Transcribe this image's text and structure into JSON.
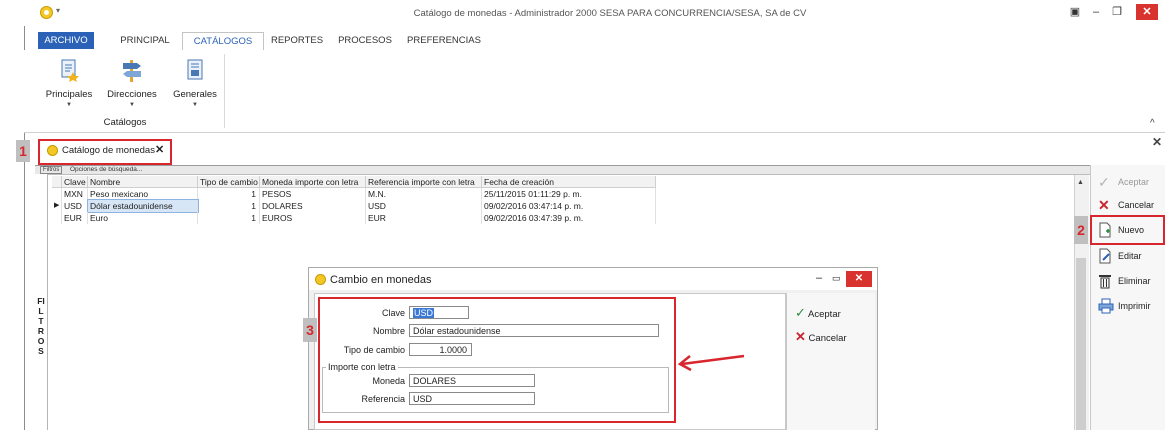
{
  "window": {
    "title": "Catálogo de monedas - Administrador 2000 SESA PARA CONCURRENCIA/SESA, SA de CV",
    "controls": {
      "restore": "▣",
      "minimize": "–",
      "maximize": "❐",
      "close": "✕"
    },
    "quick_access": "▾"
  },
  "ribbon": {
    "tabs": [
      "ARCHIVO",
      "PRINCIPAL",
      "CATÁLOGOS",
      "REPORTES",
      "PROCESOS",
      "PREFERENCIAS"
    ],
    "active_tab": "CATÁLOGOS",
    "buttons": [
      {
        "label": "Principales",
        "icon": "document-star-icon"
      },
      {
        "label": "Direcciones",
        "icon": "signpost-icon"
      },
      {
        "label": "Generales",
        "icon": "document-grid-icon"
      }
    ],
    "dropdown_glyph": "▼",
    "group_label": "Catálogos",
    "collapse_glyph": "^"
  },
  "document_tab": {
    "label": "Catálogo de monedas",
    "close": "✕",
    "close_right": "✕"
  },
  "annotations": {
    "badge1": "1",
    "badge2": "2",
    "badge3": "3",
    "accent": "#d7262d"
  },
  "search_bar": {
    "tab": "Filtros",
    "options": "Opciones de búsqueda..."
  },
  "filtros_label": "FILTROS",
  "grid": {
    "columns": [
      "Clave",
      "Nombre",
      "Tipo de cambio",
      "Moneda importe con letra",
      "Referencia importe con letra",
      "Fecha de creación"
    ],
    "rows": [
      {
        "indicator": "",
        "clave": "MXN",
        "nombre": "Peso mexicano",
        "tipo": "1",
        "moneda": "PESOS",
        "referencia": "M.N.",
        "fecha": "25/11/2015 01:11:29 p. m."
      },
      {
        "indicator": "▶",
        "clave": "USD",
        "nombre": "Dólar estadounidense",
        "tipo": "1",
        "moneda": "DOLARES",
        "referencia": "USD",
        "fecha": "09/02/2016 03:47:14 p. m."
      },
      {
        "indicator": "",
        "clave": "EUR",
        "nombre": "Euro",
        "tipo": "1",
        "moneda": "EUROS",
        "referencia": "EUR",
        "fecha": "09/02/2016 03:47:39 p. m."
      }
    ]
  },
  "side_actions": [
    "Aceptar",
    "Cancelar",
    "Nuevo",
    "Editar",
    "Eliminar",
    "Imprimir"
  ],
  "dialog": {
    "title": "Cambio en monedas",
    "controls": {
      "minimize": "–",
      "maximize": "▭",
      "close": "✕"
    },
    "labels": {
      "clave": "Clave",
      "nombre": "Nombre",
      "tipo_cambio": "Tipo de cambio",
      "group": "Importe con letra",
      "moneda": "Moneda",
      "referencia": "Referencia"
    },
    "values": {
      "clave": "USD",
      "nombre": "Dólar estadounidense",
      "tipo_cambio": "1.0000",
      "moneda": "DOLARES",
      "referencia": "USD"
    },
    "buttons": {
      "accept": "Aceptar",
      "cancel": "Cancelar"
    }
  }
}
